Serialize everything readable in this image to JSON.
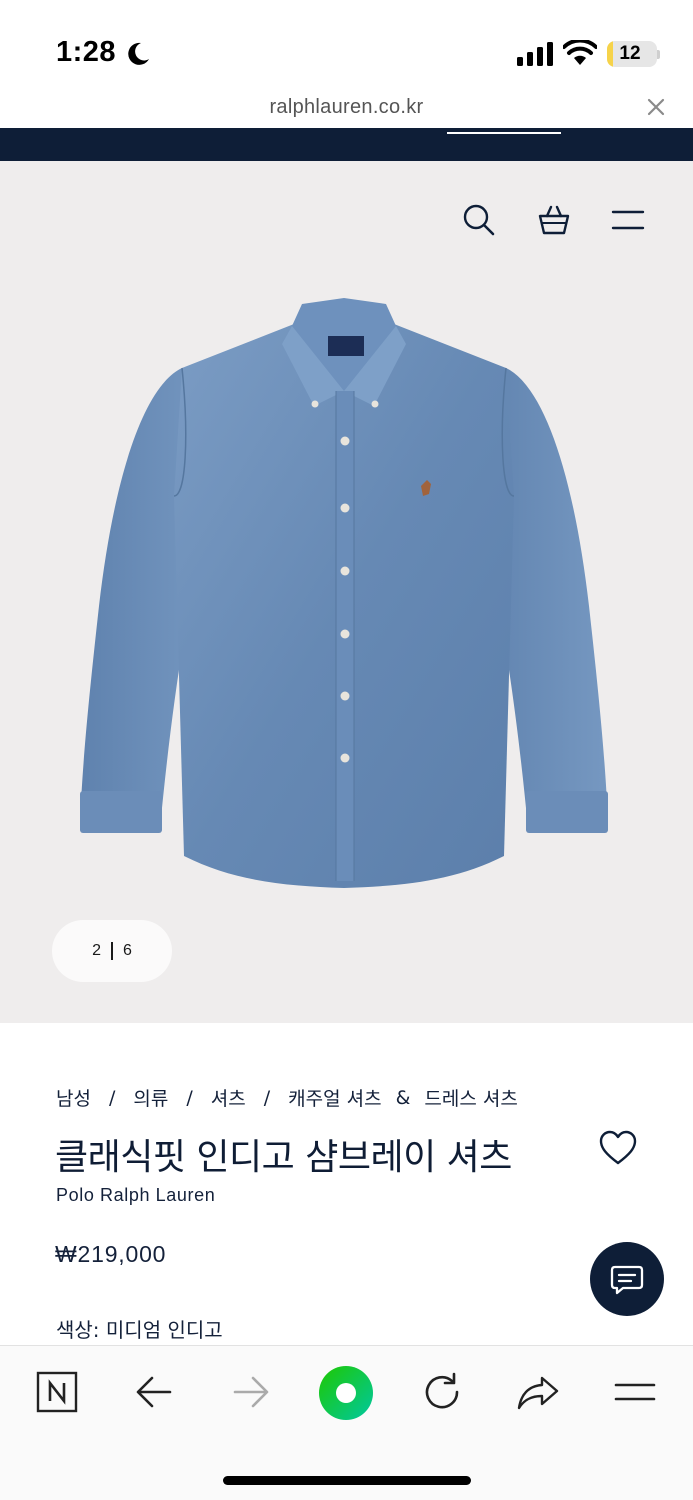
{
  "status_bar": {
    "time": "1:28",
    "battery_level": "12",
    "battery_fraction": 0.12,
    "icons": [
      "moon-icon",
      "signal-icon",
      "wifi-icon",
      "battery-icon"
    ]
  },
  "browser": {
    "url": "ralphlauren.co.kr",
    "close_icon": "close-icon"
  },
  "promo_banner": {
    "text": "",
    "link_text": ""
  },
  "header": {
    "icons": [
      "search-icon",
      "shopping-bag-icon",
      "menu-icon"
    ]
  },
  "gallery": {
    "current": "2",
    "total": "6",
    "image": "denim-shirt-image"
  },
  "breadcrumb": [
    "남성",
    "의류",
    "셔츠",
    "캐주얼 셔츠",
    "&",
    "드레스 셔츠"
  ],
  "product": {
    "title": "클래식핏 인디고 샴브레이 셔츠",
    "brand": "Polo Ralph Lauren",
    "price": "₩219,000",
    "color_label": "색상:",
    "color_value": "미디엄 인디고"
  },
  "toolbar": {
    "icons": [
      "naver-icon",
      "back-arrow-icon",
      "forward-arrow-icon",
      "green-home-icon",
      "reload-icon",
      "share-icon",
      "menu-icon"
    ]
  },
  "colors": {
    "navy": "#0e1e37",
    "image_bg": "#efeded",
    "denim": "#6b8fb8",
    "naver_green": "#1ec800"
  }
}
